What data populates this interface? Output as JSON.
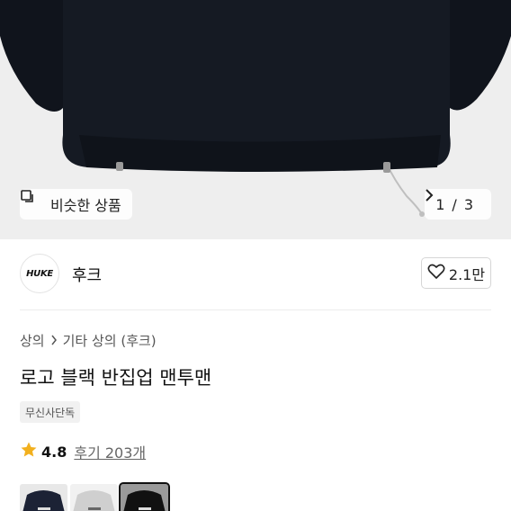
{
  "hero": {
    "similar_label": "비슷한 상품",
    "pager_current": "1",
    "pager_sep": "/",
    "pager_total": "3",
    "icons": {
      "similar": "copy-icon",
      "next": "chevron-right-icon"
    }
  },
  "brand": {
    "logo_text": "HUKE",
    "name": "후크",
    "likes": "2.1만",
    "icons": {
      "like": "heart-outline-icon"
    }
  },
  "breadcrumb": {
    "items": [
      "상의",
      "기타 상의 (후크)"
    ],
    "icons": {
      "separator": "chevron-right-icon"
    }
  },
  "product": {
    "title": "로고 블랙 반집업 맨투맨",
    "badge": "무신사단독"
  },
  "rating": {
    "score": "4.8",
    "reviews": "후기 203개",
    "star_color": "#f2b01e",
    "icons": {
      "star": "star-icon"
    }
  },
  "variants": [
    {
      "name": "navy",
      "color": "#1c2235"
    },
    {
      "name": "gray",
      "color": "#cfcfcf"
    },
    {
      "name": "black",
      "color": "#111111",
      "selected": true
    }
  ]
}
